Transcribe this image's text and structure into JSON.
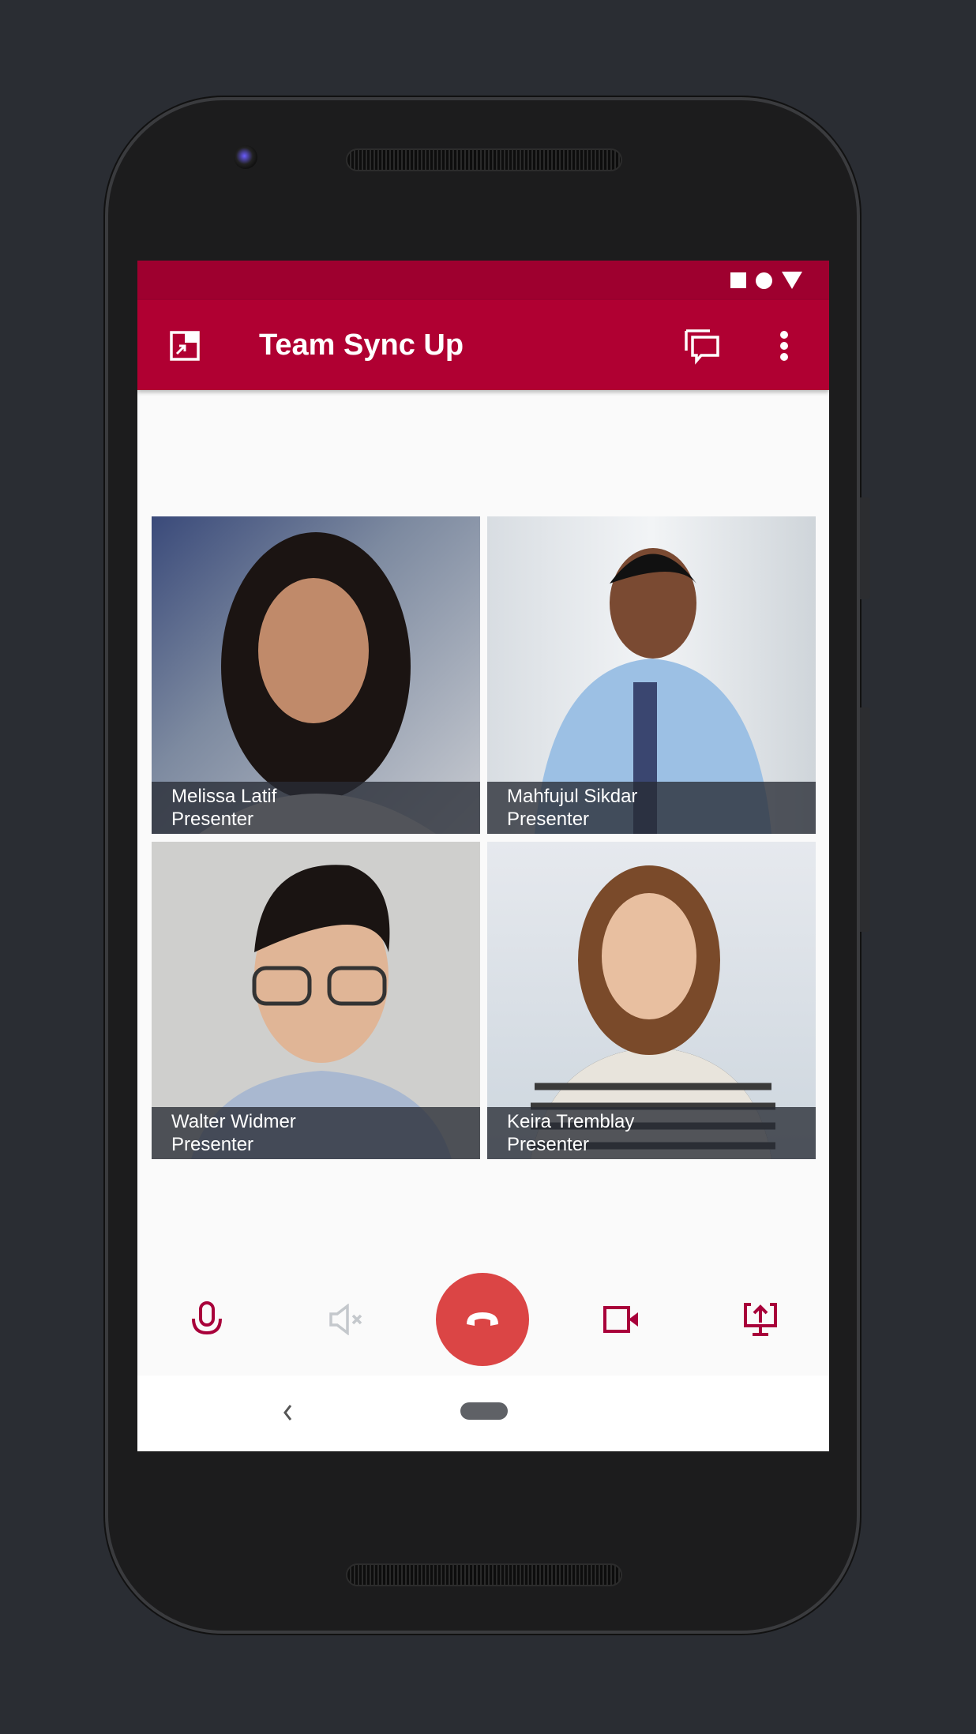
{
  "app": {
    "title": "Team Sync Up",
    "accent": "#b00032",
    "status_bar_color": "#9e002f",
    "hangup_color": "#db4545"
  },
  "status_icons": [
    "square-icon",
    "circle-icon",
    "triangle-icon"
  ],
  "toolbar": {
    "icons": [
      "picture-in-picture-icon",
      "chat-icon",
      "more-vert-icon"
    ]
  },
  "participants": [
    {
      "name": "Melissa Latif",
      "role": "Presenter"
    },
    {
      "name": "Mahfujul Sikdar",
      "role": "Presenter"
    },
    {
      "name": "Walter Widmer",
      "role": "Presenter"
    },
    {
      "name": "Keira Tremblay",
      "role": "Presenter"
    }
  ],
  "controls": [
    "microphone-icon",
    "speaker-muted-icon",
    "hang-up-icon",
    "video-camera-icon",
    "screen-share-icon"
  ],
  "nav": [
    "back-icon",
    "home-pill"
  ]
}
